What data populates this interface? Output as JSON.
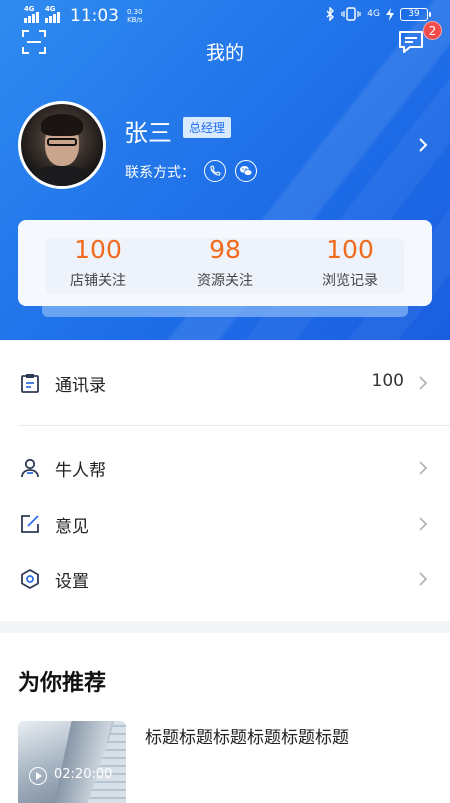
{
  "status_bar": {
    "time": "11:03",
    "sim1": "4G",
    "sim2": "4G",
    "speed_value": "0.30",
    "speed_unit": "KB/s",
    "net_type": "4G",
    "battery": "39"
  },
  "header": {
    "title": "我的",
    "message_badge": "2"
  },
  "profile": {
    "name": "张三",
    "role": "总经理",
    "contact_label": "联系方式："
  },
  "stats": [
    {
      "value": "100",
      "label": "店铺关注"
    },
    {
      "value": "98",
      "label": "资源关注"
    },
    {
      "value": "100",
      "label": "浏览记录"
    }
  ],
  "menu": {
    "contacts": {
      "label": "通讯录",
      "count": "100"
    },
    "niurenbang": {
      "label": "牛人帮"
    },
    "feedback": {
      "label": "意见"
    },
    "settings": {
      "label": "设置"
    }
  },
  "recommend": {
    "heading": "为你推荐",
    "items": [
      {
        "title": "标题标题标题标题标题标题",
        "duration": "02:20:00"
      }
    ]
  },
  "colors": {
    "primary": "#1e6fe8",
    "stat_number": "#f26a1b",
    "badge": "#f24b4b"
  }
}
